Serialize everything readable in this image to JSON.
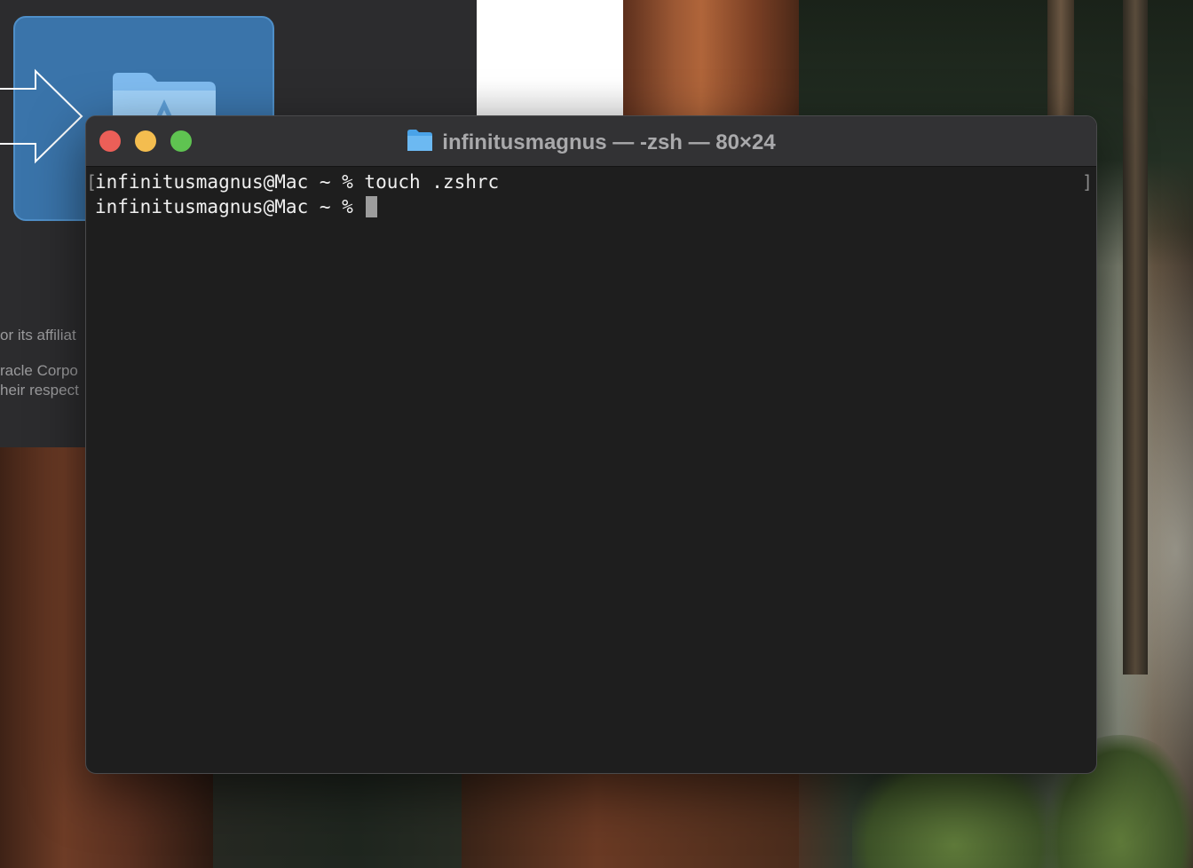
{
  "background_window": {
    "text_lines": [
      "or its affiliat",
      "racle Corpo",
      "heir respect"
    ],
    "app_tile_icon": "applications-folder-icon",
    "arrow_icon": "right-arrow-icon"
  },
  "terminal": {
    "title": "infinitusmagnus — -zsh — 80×24",
    "title_icon": "folder-icon",
    "lines": [
      "infinitusmagnus@Mac ~ % touch .zshrc",
      "infinitusmagnus@Mac ~ % "
    ],
    "colors": {
      "close": "#ec5f58",
      "minimize": "#f4bd4f",
      "zoom": "#5fc351",
      "background": "#1e1e1e"
    }
  }
}
